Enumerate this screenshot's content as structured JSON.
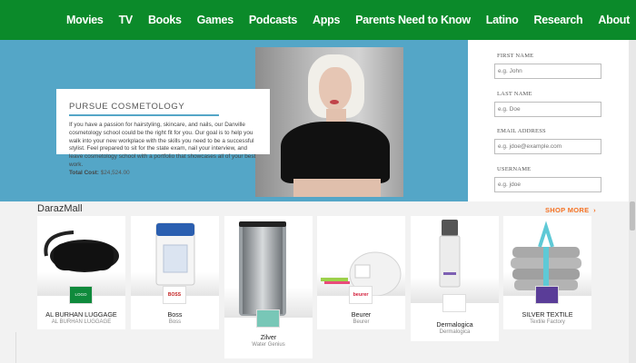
{
  "nav": {
    "items": [
      "Movies",
      "TV",
      "Books",
      "Games",
      "Podcasts",
      "Apps",
      "Parents Need to Know",
      "Latino",
      "Research",
      "About"
    ]
  },
  "promo": {
    "title": "PURSUE COSMETOLOGY",
    "body": "If you have a passion for hairstyling, skincare, and nails, our Danville cosmetology school could be the right fit for you. Our goal is to help you walk into your new workplace with the skills you need to be a successful stylist. Feel prepared to sit for the state exam, nail your interview, and leave cosmetology school with a portfolio that showcases all of your best work.",
    "cost_label": "Total Cost:",
    "cost_value": "$24,524.00"
  },
  "form": {
    "first_name_label": "FIRST NAME",
    "first_name_placeholder": "e.g. John",
    "last_name_label": "LAST NAME",
    "last_name_placeholder": "e.g. Doe",
    "email_label": "EMAIL ADDRESS",
    "email_placeholder": "e.g. jdoe@example.com",
    "username_label": "USERNAME",
    "username_placeholder": "e.g. jdoe"
  },
  "mall": {
    "title": "DarazMall",
    "shop_more": "SHOP MORE",
    "cards": [
      {
        "name": "AL BURHAN LUGGAGE",
        "sub": "AL BURHAN LUGGAGE",
        "logo": "LOGO"
      },
      {
        "name": "Boss",
        "sub": "Boss",
        "logo": "BOSS"
      },
      {
        "name": "Zilver",
        "sub": "Water Genius",
        "logo": ""
      },
      {
        "name": "Beurer",
        "sub": "Beurer",
        "logo": "beurer"
      },
      {
        "name": "Dermalogica",
        "sub": "Dermalogica",
        "logo": ""
      },
      {
        "name": "SILVER TEXTILE",
        "sub": "Textile Factory",
        "logo": ""
      }
    ]
  },
  "colors": {
    "nav_bg": "#0b8a2a",
    "hero_bg": "#54a6c7",
    "accent_orange": "#f57224"
  }
}
